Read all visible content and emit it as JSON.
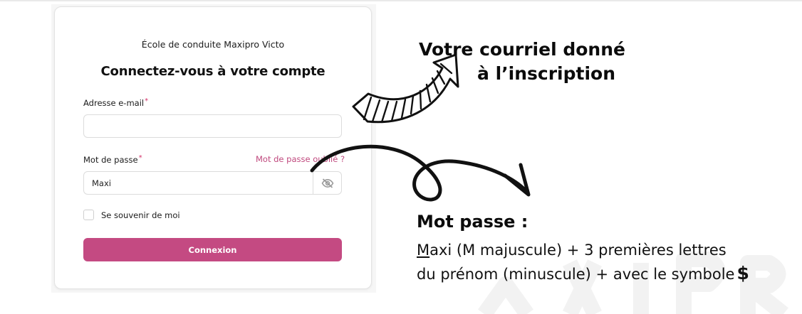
{
  "login_card": {
    "school_name": "École de conduite Maxipro Victo",
    "title": "Connectez-vous à votre compte",
    "email": {
      "label": "Adresse e-mail",
      "required_mark": "*",
      "value": ""
    },
    "password": {
      "label": "Mot de passe",
      "required_mark": "*",
      "value": "Maxi",
      "toggle_icon": "eye-off-icon"
    },
    "forgot_password": "Mot de passe oublié ?",
    "remember_me": "Se souvenir de moi",
    "submit": "Connexion"
  },
  "annotations": {
    "email_note_line1": "Votre courriel donné",
    "email_note_line2": "à l’inscription",
    "password_title": "Mot passe :",
    "password_rule_first_letter": "M",
    "password_rule_line1_rest": "axi (M majuscule) + 3 premières lettres",
    "password_rule_line2": "du  prénom (minuscule) + avec le symbole",
    "symbol": "$"
  },
  "colors": {
    "accent": "#c44a82",
    "link": "#c0497e",
    "required": "#d4346b"
  }
}
